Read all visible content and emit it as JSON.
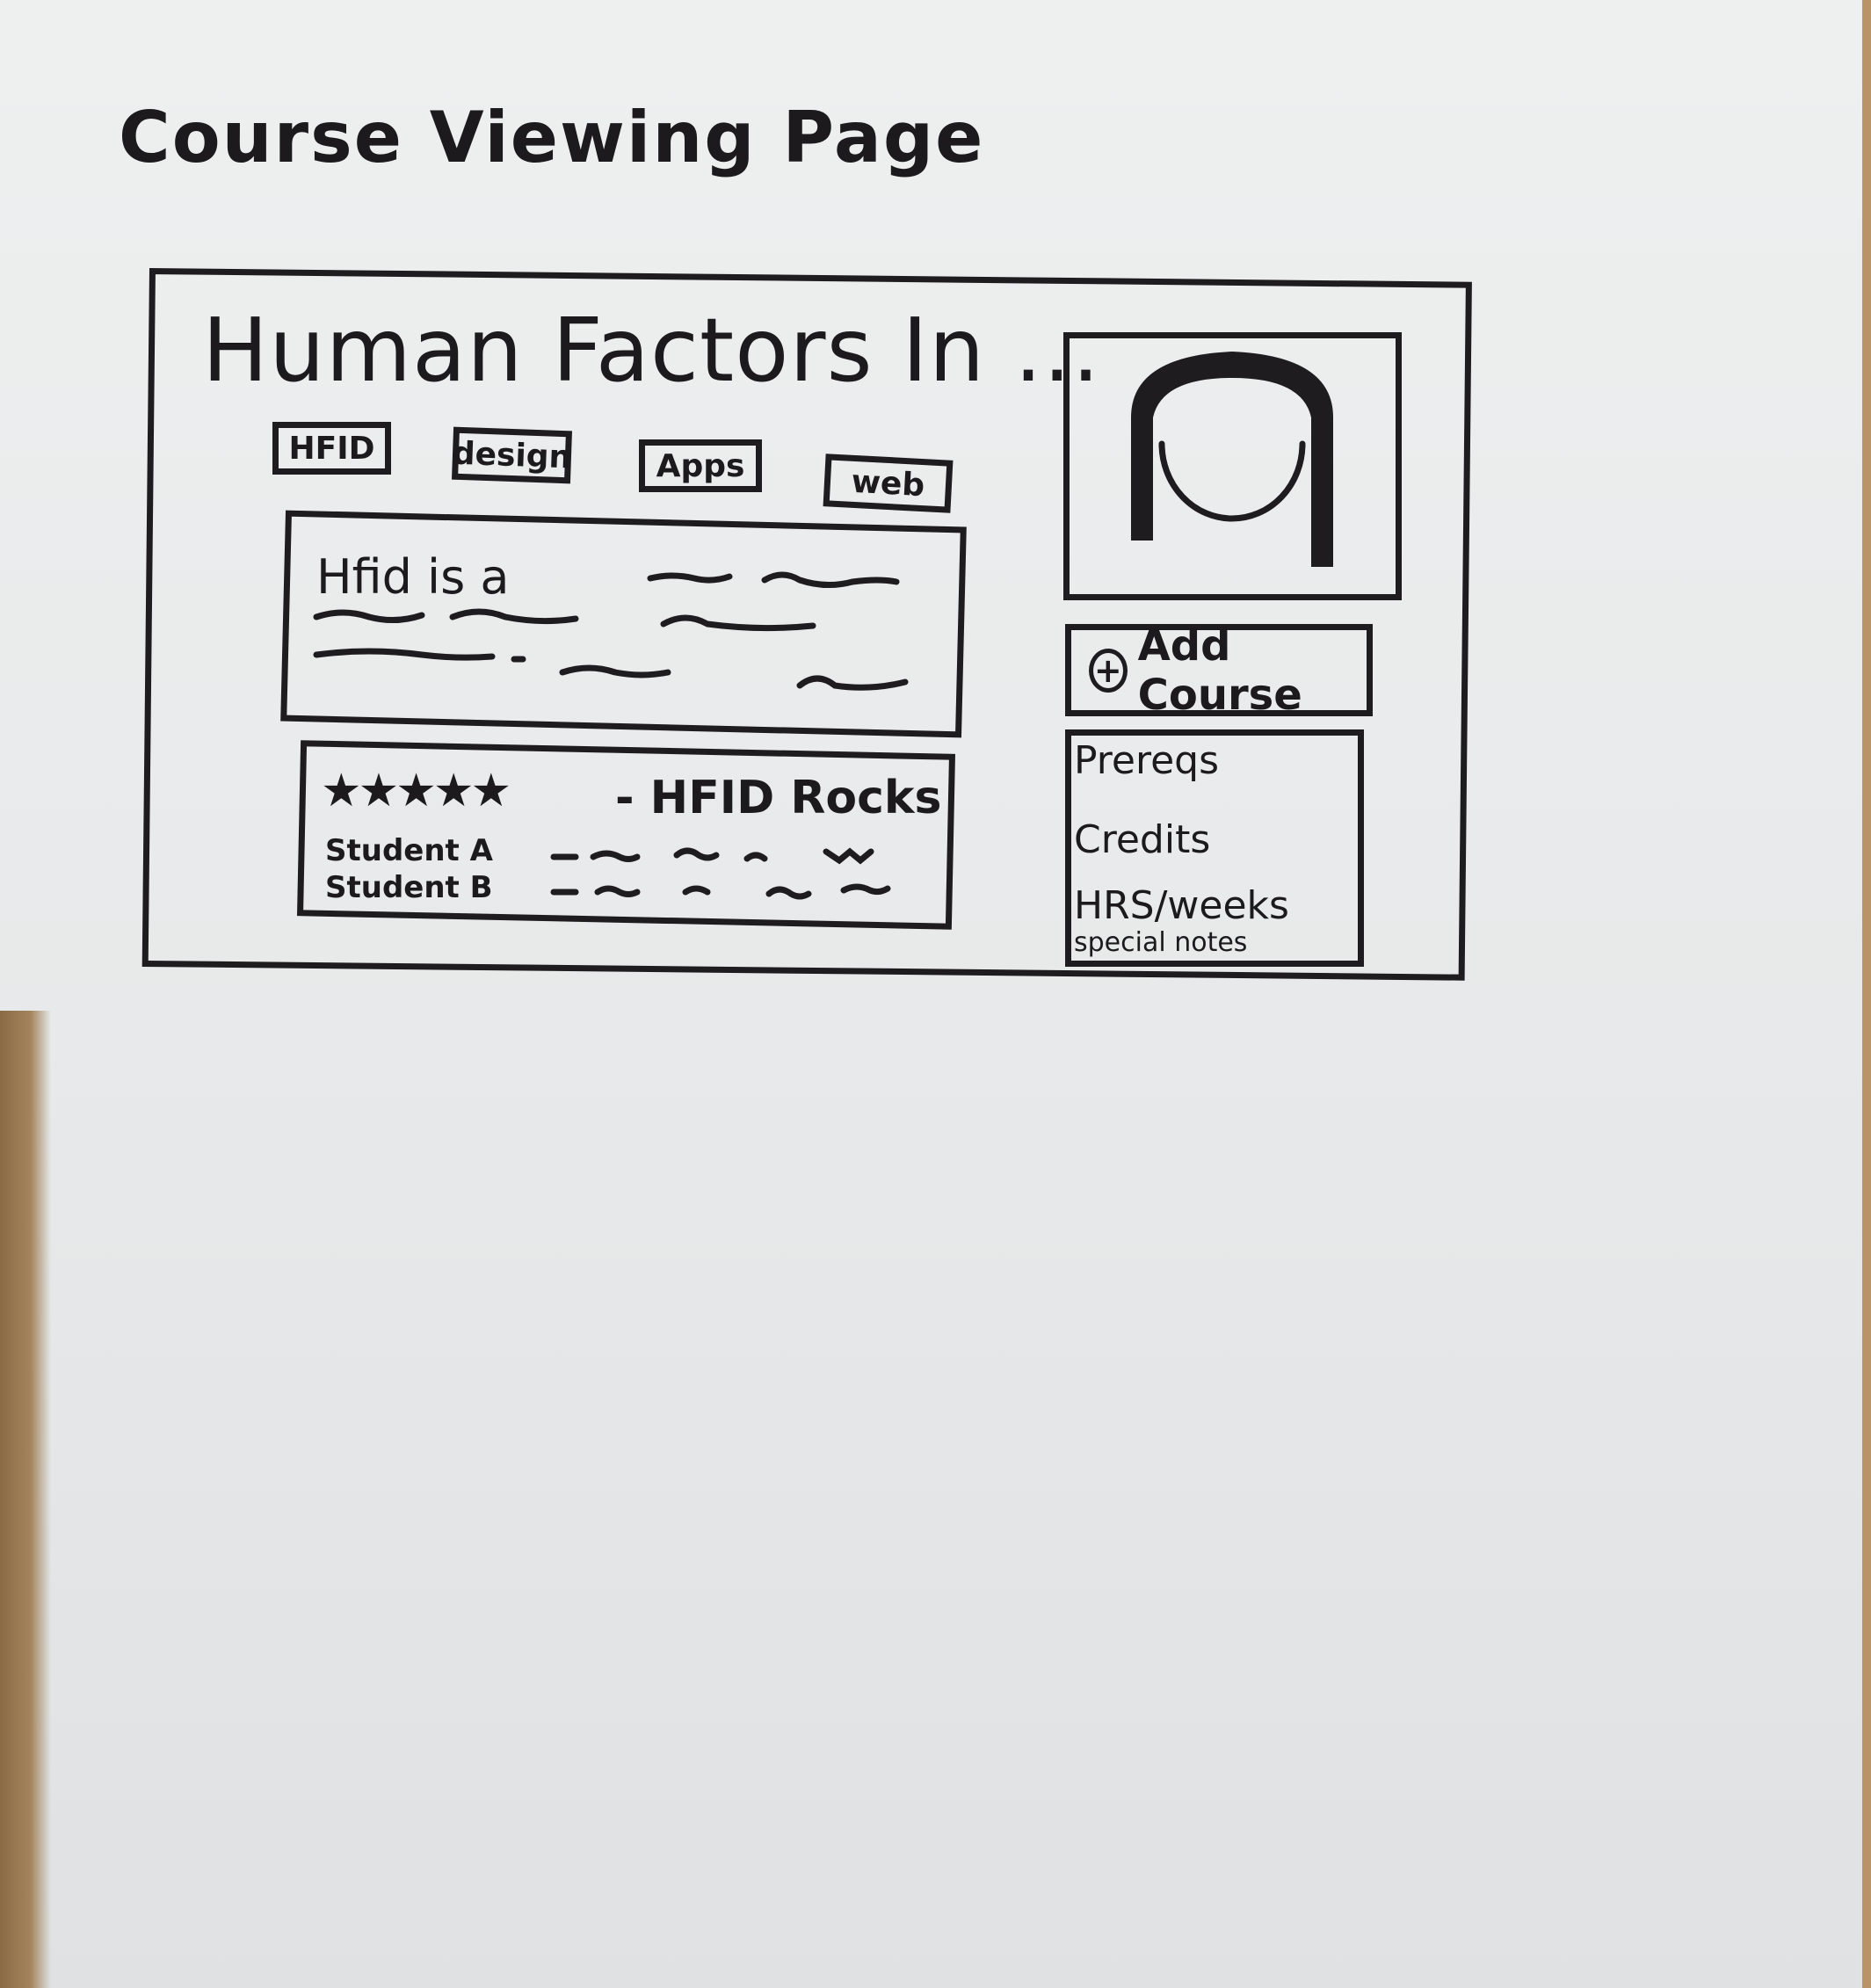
{
  "heading": "Course Viewing Page",
  "course": {
    "title": "Human Factors In ...",
    "tags": [
      "HFID",
      "design",
      "Apps",
      "web"
    ],
    "description_start": "Hfid is a"
  },
  "reviews": {
    "stars": "★★★★★",
    "title": "- HFID Rocks",
    "students": [
      "Student A",
      "Student B"
    ]
  },
  "sidebar": {
    "add_course_label": "Add Course",
    "info_items": [
      "Prereqs",
      "Credits",
      "HRS/weeks"
    ],
    "info_small": "special notes"
  }
}
